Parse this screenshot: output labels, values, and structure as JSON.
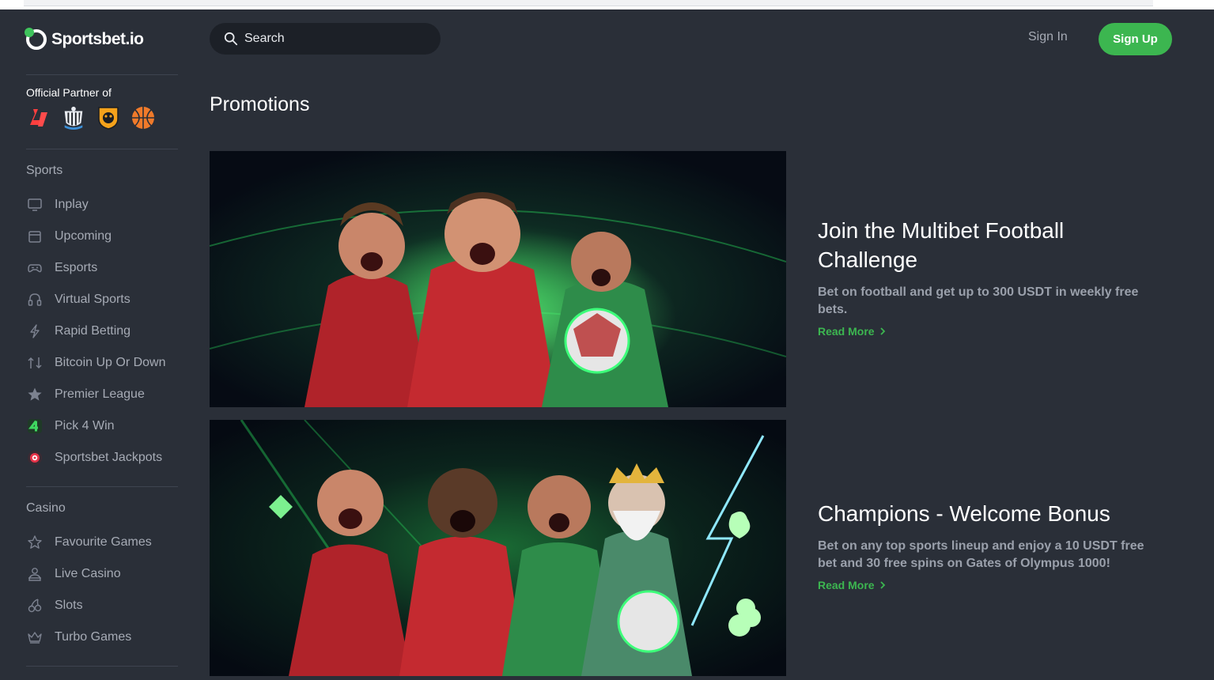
{
  "brand": {
    "name": "Sportsbet.io",
    "accent": "#3cb650",
    "bg": "#2a2f38"
  },
  "header": {
    "search_placeholder": "Search",
    "signin_label": "Sign In",
    "signup_label": "Sign Up"
  },
  "sidebar": {
    "partner_label": "Official Partner of",
    "partners": [
      "laliga-logo",
      "newcastle-logo",
      "hull-city-logo",
      "basketball-logo"
    ],
    "sports_title": "Sports",
    "sports": [
      {
        "label": "Inplay",
        "icon": "monitor-icon"
      },
      {
        "label": "Upcoming",
        "icon": "calendar-icon"
      },
      {
        "label": "Esports",
        "icon": "gamepad-icon"
      },
      {
        "label": "Virtual Sports",
        "icon": "headset-icon"
      },
      {
        "label": "Rapid Betting",
        "icon": "lightning-icon"
      },
      {
        "label": "Bitcoin Up Or Down",
        "icon": "updown-icon"
      },
      {
        "label": "Premier League",
        "icon": "star-icon"
      },
      {
        "label": "Pick 4 Win",
        "icon": "pick4-icon"
      },
      {
        "label": "Sportsbet Jackpots",
        "icon": "jackpot-icon"
      }
    ],
    "casino_title": "Casino",
    "casino": [
      {
        "label": "Favourite Games",
        "icon": "star-outline-icon"
      },
      {
        "label": "Live Casino",
        "icon": "dealer-icon"
      },
      {
        "label": "Slots",
        "icon": "cherries-icon"
      },
      {
        "label": "Turbo Games",
        "icon": "crown-icon"
      }
    ]
  },
  "main": {
    "title": "Promotions",
    "promos": [
      {
        "title": "Join the Multibet Football Challenge",
        "description": "Bet on football and get up to 300 USDT in weekly free bets.",
        "link": "Read More"
      },
      {
        "title": "Champions - Welcome Bonus",
        "description": "Bet on any top sports lineup and enjoy a 10 USDT free bet and 30 free spins on Gates of Olympus 1000!",
        "link": "Read More"
      }
    ]
  }
}
